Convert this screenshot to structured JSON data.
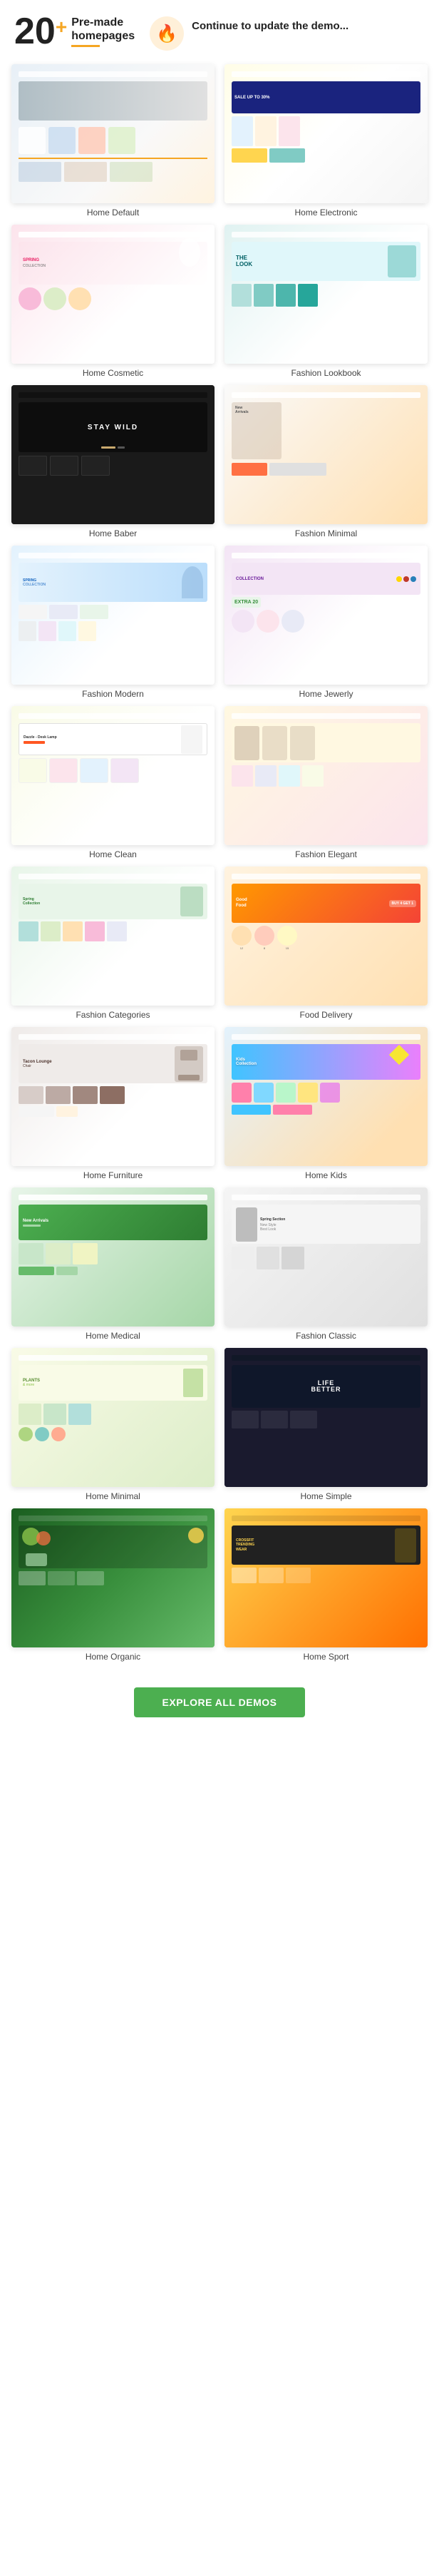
{
  "header": {
    "big_number": "20",
    "plus": "+",
    "premade_line1": "Pre-made",
    "premade_line2": "homepages",
    "continue_text": "Continue to update the demo...",
    "icon_alt": "fire-icon"
  },
  "demos": [
    {
      "id": "home-default",
      "label": "Home Default",
      "theme": "default"
    },
    {
      "id": "home-electronic",
      "label": "Home Electronic",
      "theme": "electronic"
    },
    {
      "id": "home-cosmetic",
      "label": "Home Cosmetic",
      "theme": "cosmetic"
    },
    {
      "id": "fashion-lookbook",
      "label": "Fashion Lookbook",
      "theme": "lookbook"
    },
    {
      "id": "home-baber",
      "label": "Home Baber",
      "theme": "baber"
    },
    {
      "id": "fashion-minimal",
      "label": "Fashion Minimal",
      "theme": "minimal-fashion"
    },
    {
      "id": "fashion-modern",
      "label": "Fashion Modern",
      "theme": "modern"
    },
    {
      "id": "home-jewerly",
      "label": "Home Jewerly",
      "theme": "jewerly"
    },
    {
      "id": "home-clean",
      "label": "Home Clean",
      "theme": "clean"
    },
    {
      "id": "fashion-elegant",
      "label": "Fashion Elegant",
      "theme": "elegant"
    },
    {
      "id": "fashion-categories",
      "label": "Fashion Categories",
      "theme": "categories"
    },
    {
      "id": "food-delivery",
      "label": "Food Delivery",
      "theme": "food"
    },
    {
      "id": "home-furniture",
      "label": "Home Furniture",
      "theme": "furniture"
    },
    {
      "id": "home-kids",
      "label": "Home Kids",
      "theme": "kids"
    },
    {
      "id": "home-medical",
      "label": "Home Medical",
      "theme": "medical"
    },
    {
      "id": "fashion-classic",
      "label": "Fashion Classic",
      "theme": "classic"
    },
    {
      "id": "home-minimal",
      "label": "Home Minimal",
      "theme": "minimal"
    },
    {
      "id": "home-simple",
      "label": "Home Simple",
      "theme": "simple"
    },
    {
      "id": "home-organic",
      "label": "Home Organic",
      "theme": "organic"
    },
    {
      "id": "home-sport",
      "label": "Home Sport",
      "theme": "sport"
    }
  ],
  "cta": {
    "label": "EXPLORE ALL DEMOS",
    "color": "#4caf50"
  }
}
